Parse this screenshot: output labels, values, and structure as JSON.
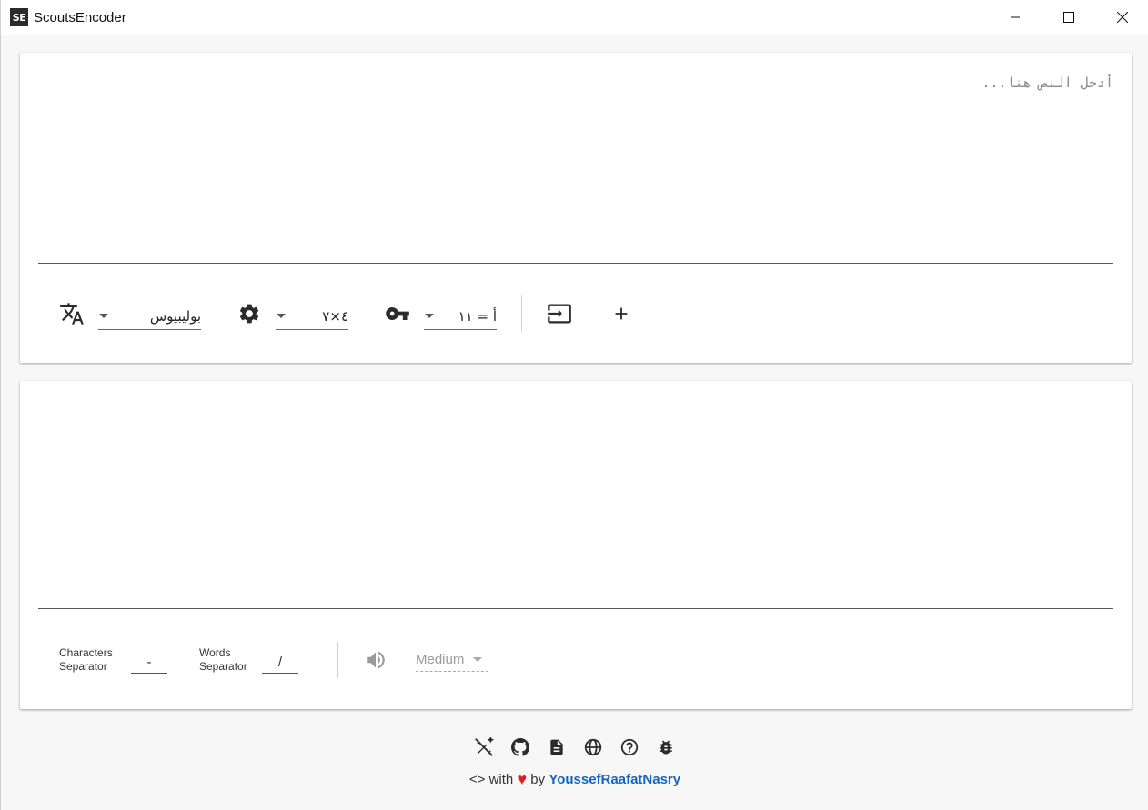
{
  "window": {
    "logo_text": "SE",
    "title": "ScoutsEncoder"
  },
  "input_card": {
    "placeholder": "أدخل النص هنا...",
    "language_value": "بوليبيوس",
    "method_value": "٤×٧",
    "key_value": "أ = ١١"
  },
  "output_card": {
    "characters_separator_label_1": "Characters",
    "characters_separator_label_2": "Separator",
    "characters_separator_value": "-",
    "words_separator_label_1": "Words",
    "words_separator_label_2": "Separator",
    "words_separator_value": "/",
    "speed_value": "Medium"
  },
  "footer": {
    "code_symbol": "<>",
    "with_text": "with",
    "heart": "♥",
    "by_text": "by",
    "author": "YoussefRaafatNasry"
  },
  "colors": {
    "accent_link": "#1565c0",
    "heart": "#e01b24",
    "underline": "#555555"
  }
}
